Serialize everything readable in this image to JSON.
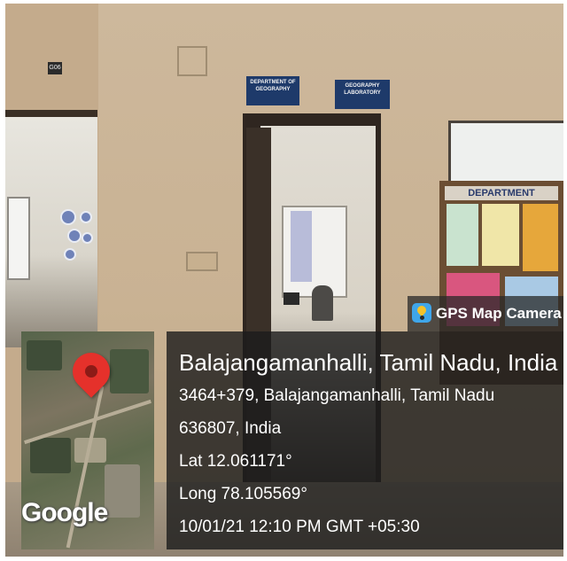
{
  "gps_badge": {
    "label": "GPS Map Camera",
    "icon": "gps-map-camera-app-icon"
  },
  "location": {
    "title": "Balajangamanhalli, Tamil Nadu, India",
    "address_line_1": "3464+379, Balajangamanhalli, Tamil Nadu",
    "address_line_2": "636807, India",
    "latitude": "Lat 12.061171°",
    "longitude": "Long 78.105569°",
    "datetime": "10/01/21 12:10 PM GMT +05:30"
  },
  "map": {
    "brand": "Google",
    "marker_icon": "location-pin-icon",
    "marker_color": "#e5312b"
  },
  "scene": {
    "room_number": "G06",
    "sign_1": "DEPARTMENT OF GEOGRAPHY",
    "sign_2": "GEOGRAPHY LABORATORY",
    "board_heading": "DEPARTMENT"
  }
}
